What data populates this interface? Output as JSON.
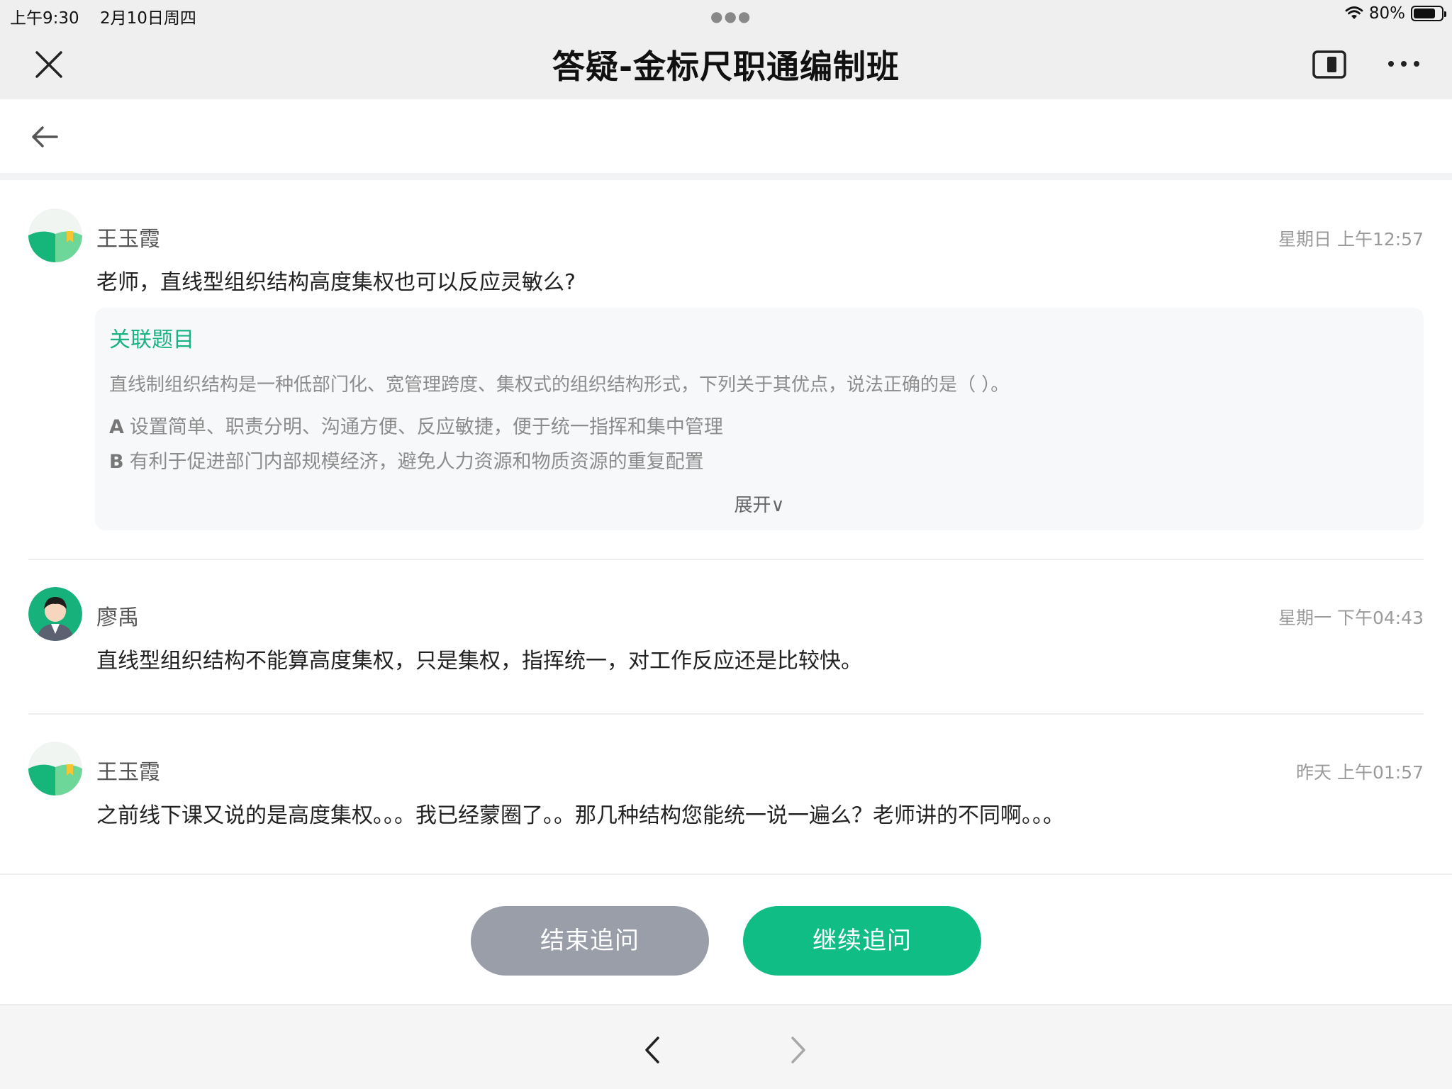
{
  "status_bar": {
    "time": "上午9:30",
    "date": "2月10日周四",
    "battery": "80%",
    "battery_level": 0.8
  },
  "nav": {
    "title": "答疑-金标尺职通编制班"
  },
  "messages": [
    {
      "name": "王玉霞",
      "time": "星期日 上午12:57",
      "text": "老师，直线型组织结构高度集权也可以反应灵敏么?"
    },
    {
      "name": "廖禹",
      "time": "星期一 下午04:43",
      "text": "直线型组织结构不能算高度集权，只是集权，指挥统一，对工作反应还是比较快。"
    },
    {
      "name": "王玉霞",
      "time": "昨天 上午01:57",
      "text": "之前线下课又说的是高度集权。。。我已经蒙圈了。。那几种结构您能统一说一遍么？老师讲的不同啊。。。"
    }
  ],
  "related": {
    "title": "关联题目",
    "question": "直线制组织结构是一种低部门化、宽管理跨度、集权式的组织结构形式，下列关于其优点，说法正确的是（ ）。",
    "options": [
      {
        "letter": "A",
        "text": "设置简单、职责分明、沟通方便、反应敏捷，便于统一指挥和集中管理"
      },
      {
        "letter": "B",
        "text": "有利于促进部门内部规模经济，避免人力资源和物质资源的重复配置"
      }
    ],
    "expand_label": "展开∨"
  },
  "actions": {
    "end_label": "结束追问",
    "continue_label": "继续追问"
  },
  "colors": {
    "accent": "#0fbd85",
    "related_title": "#1ab37f",
    "end_button": "#9a9ea8"
  }
}
